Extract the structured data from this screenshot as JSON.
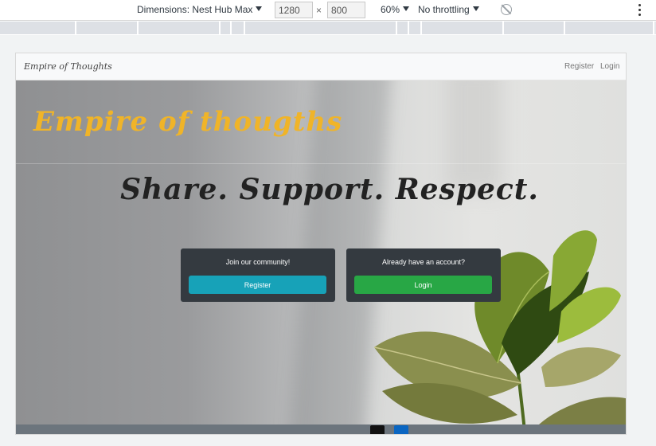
{
  "devtools": {
    "dimensions_label": "Dimensions: Nest Hub Max",
    "width_value": "1280",
    "times": "×",
    "height_value": "800",
    "zoom": "60%",
    "throttling": "No throttling",
    "icons": [
      "chevron-down-icon",
      "rotate-icon",
      "kebab-menu-icon"
    ]
  },
  "navbar": {
    "brand": "Empire of Thoughts",
    "register": "Register",
    "login": "Login"
  },
  "hero": {
    "title": "Empire of thougths",
    "tagline": "Share. Support. Respect."
  },
  "cards": {
    "join": {
      "text": "Join our community!",
      "button": "Register",
      "color": "#17a2b8"
    },
    "account": {
      "text": "Already have an account?",
      "button": "Login",
      "color": "#28a745"
    }
  },
  "footer": {
    "icons": [
      "github-icon",
      "linkedin-icon"
    ]
  },
  "colors": {
    "title_accent": "#f0b428",
    "card_bg": "#343a40",
    "footer_bg": "#6c757d"
  }
}
